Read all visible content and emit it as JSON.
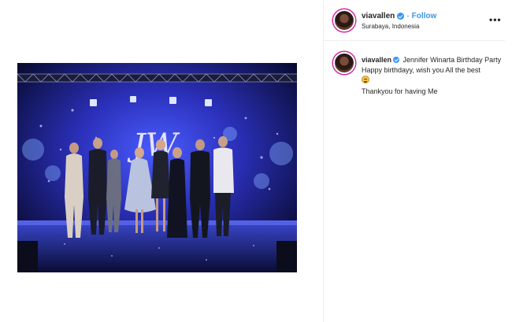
{
  "post": {
    "username": "viavallen",
    "follow_label": "Follow",
    "location": "Surabaya, Indonesia",
    "more_label": "•••"
  },
  "caption": {
    "username": "viavallen",
    "title": "Jennifer Winarta Birthday Party",
    "line2": "Happy birthdayy, wish you All the best",
    "emoji": "grinning-face-emoji",
    "line3": "Thankyou for having Me"
  },
  "photo": {
    "stage_logo": "JW"
  },
  "colors": {
    "follow_blue": "#3897f0",
    "verified_blue": "#3897f0",
    "divider": "#efefef",
    "stage_blue": "#2c3bd6"
  }
}
